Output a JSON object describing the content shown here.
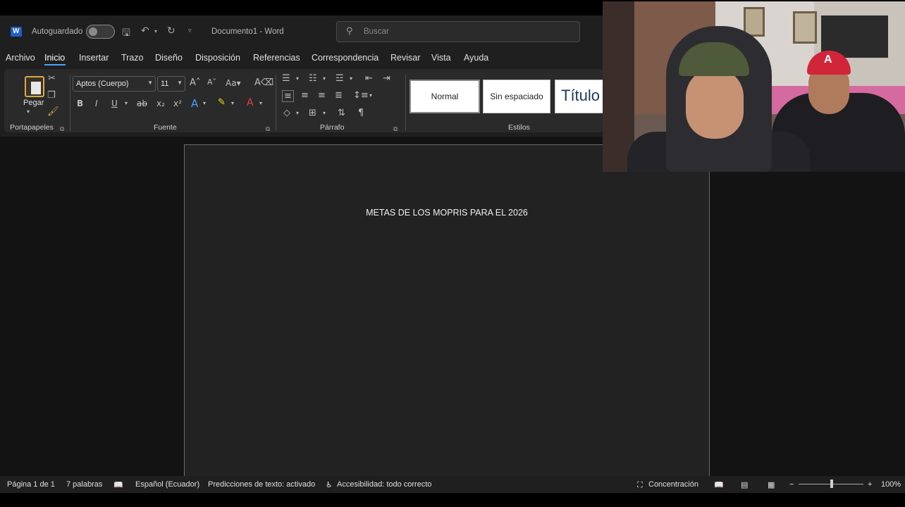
{
  "titlebar": {
    "autosave_label": "Autoguardado",
    "document_title": "Documento1 - Word",
    "search_placeholder": "Buscar",
    "icons": [
      "word-logo-icon",
      "save-icon",
      "undo-icon",
      "redo-icon",
      "customize-icon",
      "search-icon"
    ]
  },
  "menu": {
    "items": [
      "Archivo",
      "Inicio",
      "Insertar",
      "Trazo",
      "Diseño",
      "Disposición",
      "Referencias",
      "Correspondencia",
      "Revisar",
      "Vista",
      "Ayuda"
    ],
    "active": "Inicio"
  },
  "ribbon": {
    "clipboard": {
      "paste_label": "Pegar",
      "group_label": "Portapapeles"
    },
    "font": {
      "font_name": "Aptos (Cuerpo)",
      "font_size": "11",
      "group_label": "Fuente"
    },
    "paragraph": {
      "group_label": "Párrafo"
    },
    "styles": {
      "group_label": "Estilos",
      "items": [
        "Normal",
        "Sin espaciado",
        "Título"
      ]
    }
  },
  "document": {
    "text": "METAS DE LOS MOPRIS PARA EL 2026"
  },
  "statusbar": {
    "page": "Página 1 de 1",
    "words": "7 palabras",
    "language": "Español (Ecuador)",
    "predictions": "Predicciones de texto: activado",
    "accessibility": "Accesibilidad: todo correcto",
    "focus": "Concentración",
    "zoom": "100%"
  },
  "colors": {
    "accent": "#4aa0ff",
    "chrome": "#1f1f1f",
    "page": "#222222"
  }
}
